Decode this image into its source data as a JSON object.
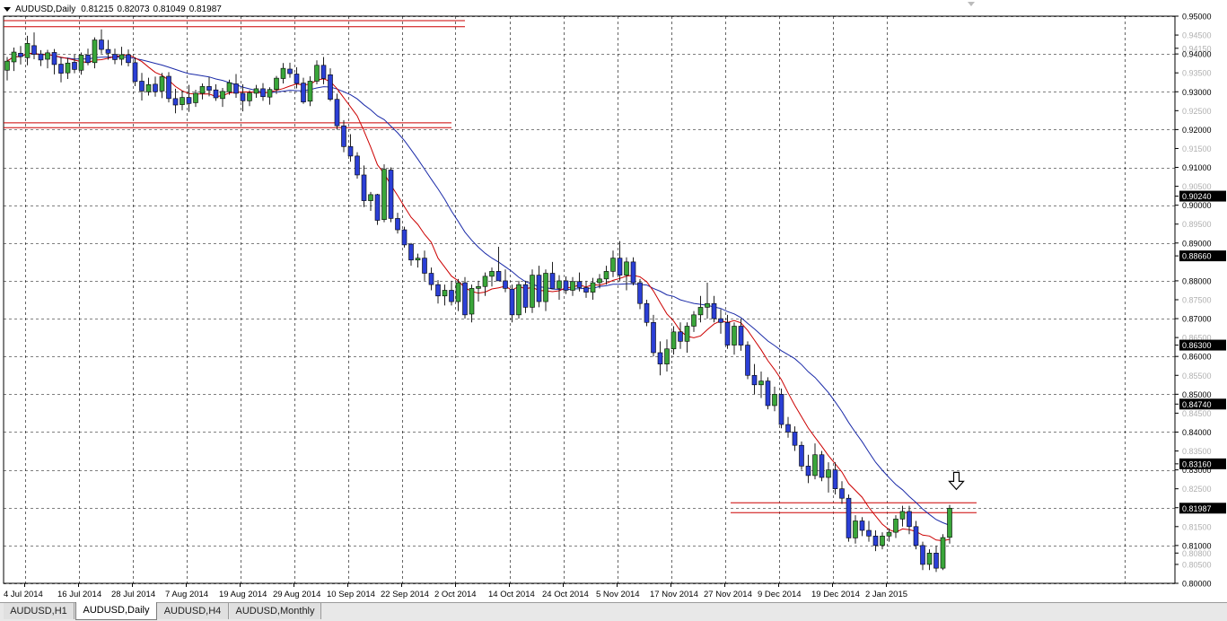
{
  "window": {
    "symbol": "AUDUSD,Daily",
    "ohlc": [
      "0.81215",
      "0.82073",
      "0.81049",
      "0.81987"
    ]
  },
  "tabs": [
    {
      "label": "AUDUSD,H1",
      "active": false
    },
    {
      "label": "AUDUSD,Daily",
      "active": true
    },
    {
      "label": "AUDUSD,H4",
      "active": false
    },
    {
      "label": "AUDUSD,Monthly",
      "active": false
    }
  ],
  "colors": {
    "bull": "#3aa63a",
    "bear": "#2b3fd6",
    "wick": "#202020",
    "ma_fast": "#cc0000",
    "ma_slow": "#1a2aa8",
    "hline": "#cc0000",
    "grid": "#000000",
    "price_highlight": "#000000"
  },
  "chart_data": {
    "type": "candlestick",
    "y_axis": {
      "min": 0.8,
      "max": 0.95,
      "ticks": [
        {
          "v": 0.95,
          "label": "0.95000",
          "major": true
        },
        {
          "v": 0.945,
          "label": "0.94500",
          "major": false
        },
        {
          "v": 0.9415,
          "label": "0.94150",
          "major": false
        },
        {
          "v": 0.94,
          "label": "0.94000",
          "major": true
        },
        {
          "v": 0.935,
          "label": "0.93500",
          "major": false
        },
        {
          "v": 0.93,
          "label": "0.93000",
          "major": true
        },
        {
          "v": 0.925,
          "label": "0.92500",
          "major": false
        },
        {
          "v": 0.92,
          "label": "0.92000",
          "major": true
        },
        {
          "v": 0.91,
          "label": "0.91000",
          "major": true
        },
        {
          "v": 0.915,
          "label": "0.91500",
          "major": false
        },
        {
          "v": 0.905,
          "label": "0.90500",
          "major": false
        },
        {
          "v": 0.9024,
          "label": "0.90240",
          "major": false
        },
        {
          "v": 0.9,
          "label": "0.90000",
          "major": true
        },
        {
          "v": 0.895,
          "label": "0.89500",
          "major": false
        },
        {
          "v": 0.89,
          "label": "0.89000",
          "major": true
        },
        {
          "v": 0.8866,
          "label": "0.88660",
          "major": false
        },
        {
          "v": 0.88,
          "label": "0.88000",
          "major": true
        },
        {
          "v": 0.875,
          "label": "0.87500",
          "major": false
        },
        {
          "v": 0.87,
          "label": "0.87000",
          "major": true
        },
        {
          "v": 0.865,
          "label": "0.86500",
          "major": false
        },
        {
          "v": 0.863,
          "label": "0.86300",
          "major": false
        },
        {
          "v": 0.86,
          "label": "0.86000",
          "major": true
        },
        {
          "v": 0.855,
          "label": "0.85500",
          "major": false
        },
        {
          "v": 0.85,
          "label": "0.85000",
          "major": true
        },
        {
          "v": 0.8474,
          "label": "0.84740",
          "major": false
        },
        {
          "v": 0.845,
          "label": "0.84500",
          "major": false
        },
        {
          "v": 0.84,
          "label": "0.84000",
          "major": true
        },
        {
          "v": 0.835,
          "label": "0.83500",
          "major": false
        },
        {
          "v": 0.8316,
          "label": "0.83160",
          "major": false
        },
        {
          "v": 0.83,
          "label": "0.83000",
          "major": true
        },
        {
          "v": 0.825,
          "label": "0.82500",
          "major": false
        },
        {
          "v": 0.82,
          "label": "0.82000",
          "major": true
        },
        {
          "v": 0.815,
          "label": "0.81500",
          "major": false
        },
        {
          "v": 0.81,
          "label": "0.81000",
          "major": true
        },
        {
          "v": 0.808,
          "label": "0.80800",
          "major": false
        },
        {
          "v": 0.805,
          "label": "0.80500",
          "major": false
        },
        {
          "v": 0.8,
          "label": "0.80000",
          "major": true
        }
      ]
    },
    "x_axis": {
      "labels": [
        {
          "i": 0,
          "label": "4 Jul 2014"
        },
        {
          "i": 8,
          "label": "16 Jul 2014"
        },
        {
          "i": 16,
          "label": "28 Jul 2014"
        },
        {
          "i": 24,
          "label": "7 Aug 2014"
        },
        {
          "i": 32,
          "label": "19 Aug 2014"
        },
        {
          "i": 40,
          "label": "29 Aug 2014"
        },
        {
          "i": 48,
          "label": "10 Sep 2014"
        },
        {
          "i": 56,
          "label": "22 Sep 2014"
        },
        {
          "i": 64,
          "label": "2 Oct 2014"
        },
        {
          "i": 72,
          "label": "14 Oct 2014"
        },
        {
          "i": 80,
          "label": "24 Oct 2014"
        },
        {
          "i": 88,
          "label": "5 Nov 2014"
        },
        {
          "i": 96,
          "label": "17 Nov 2014"
        },
        {
          "i": 104,
          "label": "27 Nov 2014"
        },
        {
          "i": 112,
          "label": "9 Dec 2014"
        },
        {
          "i": 120,
          "label": "19 Dec 2014"
        },
        {
          "i": 128,
          "label": "2 Jan 2015"
        }
      ]
    },
    "horizontal_lines": [
      {
        "y": 0.9488,
        "from_i": 0,
        "to_i": 68
      },
      {
        "y": 0.9472,
        "from_i": 0,
        "to_i": 68
      },
      {
        "y": 0.9218,
        "from_i": 0,
        "to_i": 66
      },
      {
        "y": 0.9205,
        "from_i": 0,
        "to_i": 66
      },
      {
        "y": 0.8213,
        "from_i": 108,
        "to_i": 144
      },
      {
        "y": 0.8187,
        "from_i": 108,
        "to_i": 144
      }
    ],
    "highlighted_prices": [
      "0.90240",
      "0.88660",
      "0.86300",
      "0.84740",
      "0.83160",
      "0.81987"
    ],
    "candles": [
      [
        0.9357,
        0.9392,
        0.933,
        0.9381
      ],
      [
        0.9379,
        0.9417,
        0.9355,
        0.9405
      ],
      [
        0.9402,
        0.9421,
        0.9372,
        0.9393
      ],
      [
        0.939,
        0.9448,
        0.937,
        0.9428
      ],
      [
        0.9422,
        0.9457,
        0.9386,
        0.9399
      ],
      [
        0.94,
        0.941,
        0.9368,
        0.9384
      ],
      [
        0.9386,
        0.9411,
        0.9362,
        0.9403
      ],
      [
        0.9404,
        0.9413,
        0.9346,
        0.9372
      ],
      [
        0.9373,
        0.9392,
        0.9325,
        0.9349
      ],
      [
        0.935,
        0.939,
        0.9334,
        0.9376
      ],
      [
        0.9378,
        0.9398,
        0.9349,
        0.9359
      ],
      [
        0.9357,
        0.9404,
        0.9345,
        0.9397
      ],
      [
        0.9397,
        0.9414,
        0.937,
        0.9377
      ],
      [
        0.9377,
        0.9444,
        0.9362,
        0.9437
      ],
      [
        0.9437,
        0.9465,
        0.9401,
        0.9412
      ],
      [
        0.9412,
        0.9437,
        0.9385,
        0.9402
      ],
      [
        0.9399,
        0.9414,
        0.9373,
        0.9385
      ],
      [
        0.9386,
        0.9419,
        0.937,
        0.9398
      ],
      [
        0.9398,
        0.9412,
        0.9367,
        0.9377
      ],
      [
        0.9377,
        0.9391,
        0.9315,
        0.9327
      ],
      [
        0.9328,
        0.935,
        0.9277,
        0.9302
      ],
      [
        0.93,
        0.9337,
        0.929,
        0.9319
      ],
      [
        0.932,
        0.934,
        0.9287,
        0.93
      ],
      [
        0.9302,
        0.935,
        0.9283,
        0.934
      ],
      [
        0.9341,
        0.9352,
        0.9272,
        0.9282
      ],
      [
        0.9282,
        0.9308,
        0.9243,
        0.9265
      ],
      [
        0.9266,
        0.9303,
        0.9251,
        0.9285
      ],
      [
        0.9285,
        0.9318,
        0.9247,
        0.9269
      ],
      [
        0.9271,
        0.9305,
        0.926,
        0.9296
      ],
      [
        0.9296,
        0.9322,
        0.928,
        0.9314
      ],
      [
        0.9314,
        0.9339,
        0.9288,
        0.9304
      ],
      [
        0.9305,
        0.932,
        0.9276,
        0.9284
      ],
      [
        0.9282,
        0.931,
        0.926,
        0.9301
      ],
      [
        0.93,
        0.9332,
        0.9292,
        0.9324
      ],
      [
        0.9321,
        0.9347,
        0.9284,
        0.9296
      ],
      [
        0.9296,
        0.932,
        0.9248,
        0.9276
      ],
      [
        0.9276,
        0.9304,
        0.9262,
        0.9297
      ],
      [
        0.9296,
        0.9318,
        0.9284,
        0.9308
      ],
      [
        0.9308,
        0.9323,
        0.9276,
        0.9287
      ],
      [
        0.9286,
        0.9312,
        0.9266,
        0.9306
      ],
      [
        0.9306,
        0.9342,
        0.9294,
        0.9336
      ],
      [
        0.9335,
        0.9376,
        0.9322,
        0.9362
      ],
      [
        0.936,
        0.9377,
        0.9337,
        0.9348
      ],
      [
        0.9347,
        0.9365,
        0.9309,
        0.9322
      ],
      [
        0.9323,
        0.9337,
        0.9268,
        0.9273
      ],
      [
        0.9275,
        0.9341,
        0.9262,
        0.9328
      ],
      [
        0.9328,
        0.9383,
        0.932,
        0.937
      ],
      [
        0.937,
        0.9392,
        0.932,
        0.9335
      ],
      [
        0.9345,
        0.9362,
        0.9275,
        0.928
      ],
      [
        0.928,
        0.9295,
        0.92,
        0.921
      ],
      [
        0.921,
        0.9225,
        0.914,
        0.9155
      ],
      [
        0.9155,
        0.9188,
        0.9115,
        0.913
      ],
      [
        0.913,
        0.914,
        0.907,
        0.908
      ],
      [
        0.908,
        0.9105,
        0.8995,
        0.9012
      ],
      [
        0.9012,
        0.9035,
        0.8985,
        0.9028
      ],
      [
        0.9028,
        0.903,
        0.8948,
        0.896
      ],
      [
        0.8962,
        0.9108,
        0.8955,
        0.9095
      ],
      [
        0.9093,
        0.91,
        0.8955,
        0.8965
      ],
      [
        0.8965,
        0.898,
        0.8925,
        0.8935
      ],
      [
        0.8935,
        0.8943,
        0.8888,
        0.8895
      ],
      [
        0.8897,
        0.89,
        0.884,
        0.8855
      ],
      [
        0.8855,
        0.8872,
        0.8835,
        0.886
      ],
      [
        0.886,
        0.888,
        0.88,
        0.882
      ],
      [
        0.882,
        0.8835,
        0.8775,
        0.879
      ],
      [
        0.879,
        0.8802,
        0.874,
        0.876
      ],
      [
        0.876,
        0.879,
        0.8735,
        0.8775
      ],
      [
        0.8775,
        0.88,
        0.8735,
        0.8745
      ],
      [
        0.8745,
        0.8805,
        0.872,
        0.8795
      ],
      [
        0.8795,
        0.881,
        0.87,
        0.871
      ],
      [
        0.8712,
        0.879,
        0.869,
        0.878
      ],
      [
        0.878,
        0.88,
        0.8745,
        0.8785
      ],
      [
        0.8785,
        0.8822,
        0.876,
        0.8812
      ],
      [
        0.8812,
        0.8835,
        0.8785,
        0.8825
      ],
      [
        0.8825,
        0.889,
        0.8802,
        0.88
      ],
      [
        0.88,
        0.883,
        0.877,
        0.878
      ],
      [
        0.8778,
        0.879,
        0.869,
        0.871
      ],
      [
        0.871,
        0.88,
        0.87,
        0.879
      ],
      [
        0.879,
        0.88,
        0.8715,
        0.873
      ],
      [
        0.873,
        0.883,
        0.8715,
        0.8815
      ],
      [
        0.8815,
        0.884,
        0.873,
        0.8745
      ],
      [
        0.8745,
        0.883,
        0.872,
        0.882
      ],
      [
        0.882,
        0.885,
        0.878,
        0.878
      ],
      [
        0.878,
        0.8815,
        0.875,
        0.88
      ],
      [
        0.88,
        0.8812,
        0.8765,
        0.8775
      ],
      [
        0.8775,
        0.881,
        0.876,
        0.8798
      ],
      [
        0.8798,
        0.8822,
        0.8772,
        0.8782
      ],
      [
        0.8782,
        0.88,
        0.8755,
        0.877
      ],
      [
        0.877,
        0.8808,
        0.875,
        0.8795
      ],
      [
        0.8795,
        0.8818,
        0.878,
        0.8805
      ],
      [
        0.8805,
        0.884,
        0.879,
        0.8825
      ],
      [
        0.8825,
        0.888,
        0.881,
        0.886
      ],
      [
        0.886,
        0.8905,
        0.88,
        0.8815
      ],
      [
        0.8815,
        0.8862,
        0.8775,
        0.885
      ],
      [
        0.885,
        0.8862,
        0.8788,
        0.8795
      ],
      [
        0.8795,
        0.8805,
        0.8725,
        0.874
      ],
      [
        0.874,
        0.875,
        0.868,
        0.869
      ],
      [
        0.869,
        0.871,
        0.86,
        0.861
      ],
      [
        0.861,
        0.864,
        0.855,
        0.858
      ],
      [
        0.858,
        0.8645,
        0.856,
        0.862
      ],
      [
        0.862,
        0.868,
        0.8605,
        0.8665
      ],
      [
        0.8665,
        0.869,
        0.862,
        0.864
      ],
      [
        0.864,
        0.869,
        0.861,
        0.868
      ],
      [
        0.868,
        0.872,
        0.8665,
        0.871
      ],
      [
        0.871,
        0.876,
        0.869,
        0.873
      ],
      [
        0.873,
        0.8795,
        0.87,
        0.874
      ],
      [
        0.874,
        0.876,
        0.869,
        0.87
      ],
      [
        0.87,
        0.8725,
        0.866,
        0.869
      ],
      [
        0.869,
        0.871,
        0.862,
        0.863
      ],
      [
        0.863,
        0.869,
        0.8605,
        0.868
      ],
      [
        0.868,
        0.87,
        0.8615,
        0.863
      ],
      [
        0.863,
        0.864,
        0.854,
        0.855
      ],
      [
        0.855,
        0.858,
        0.85,
        0.8525
      ]
    ],
    "candles_tail": [
      [
        0.8525,
        0.856,
        0.849,
        0.8535
      ],
      [
        0.8535,
        0.8545,
        0.846,
        0.847
      ],
      [
        0.847,
        0.852,
        0.8455,
        0.85
      ],
      [
        0.85,
        0.8515,
        0.841,
        0.842
      ],
      [
        0.842,
        0.844,
        0.8385,
        0.84
      ],
      [
        0.84,
        0.8415,
        0.835,
        0.8365
      ],
      [
        0.8365,
        0.8375,
        0.83,
        0.831
      ],
      [
        0.831,
        0.834,
        0.8265,
        0.8285
      ],
      [
        0.8285,
        0.837,
        0.8275,
        0.834
      ],
      [
        0.834,
        0.835,
        0.827,
        0.828
      ],
      [
        0.828,
        0.832,
        0.824,
        0.83
      ],
      [
        0.83,
        0.832,
        0.8235,
        0.825
      ],
      [
        0.825,
        0.827,
        0.821,
        0.8225
      ],
      [
        0.8225,
        0.8235,
        0.811,
        0.812
      ],
      [
        0.812,
        0.818,
        0.8105,
        0.8165
      ],
      [
        0.8165,
        0.8175,
        0.8125,
        0.814
      ],
      [
        0.814,
        0.8165,
        0.811,
        0.8125
      ],
      [
        0.8125,
        0.814,
        0.8085,
        0.81
      ],
      [
        0.81,
        0.8135,
        0.809,
        0.8125
      ],
      [
        0.8125,
        0.8145,
        0.811,
        0.8135
      ],
      [
        0.8135,
        0.818,
        0.812,
        0.817
      ],
      [
        0.817,
        0.8205,
        0.815,
        0.819
      ],
      [
        0.819,
        0.8205,
        0.813,
        0.815
      ],
      [
        0.815,
        0.8165,
        0.809,
        0.81
      ],
      [
        0.81,
        0.811,
        0.8035,
        0.805
      ],
      [
        0.805,
        0.809,
        0.8035,
        0.808
      ],
      [
        0.808,
        0.81,
        0.803,
        0.804
      ],
      [
        0.804,
        0.813,
        0.8035,
        0.8121
      ],
      [
        0.81215,
        0.82073,
        0.81049,
        0.81987
      ]
    ],
    "arrow": {
      "i": 141,
      "price": 0.8265,
      "direction": "down"
    }
  }
}
